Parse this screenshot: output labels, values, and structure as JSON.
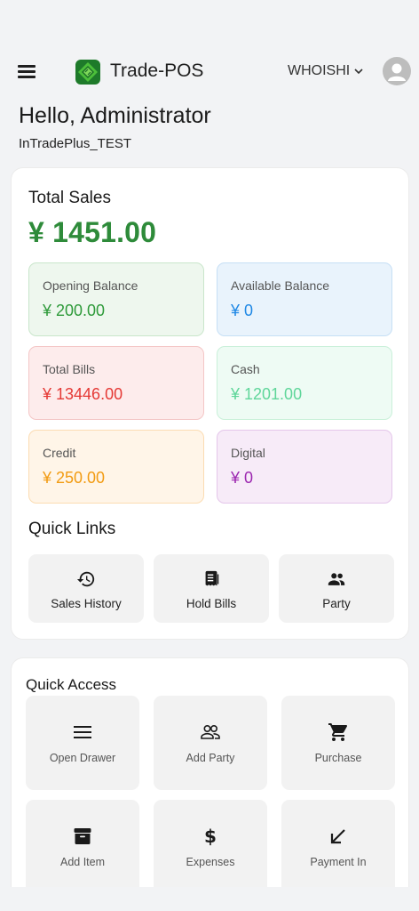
{
  "header": {
    "brand": "Trade-POS",
    "store_name": "WHOISHI",
    "greeting": "Hello, Administrator",
    "company": "InTradePlus_TEST"
  },
  "sales": {
    "title": "Total Sales",
    "total": "¥ 1451.00",
    "stats": [
      {
        "label": "Opening Balance",
        "value": "¥ 200.00",
        "color": "#2e9a3a"
      },
      {
        "label": "Available Balance",
        "value": "¥ 0",
        "color": "#1f88e5"
      },
      {
        "label": "Total Bills",
        "value": "¥ 13446.00",
        "color": "#e53935"
      },
      {
        "label": "Cash",
        "value": "¥ 1201.00",
        "color": "#5fd69a"
      },
      {
        "label": "Credit",
        "value": "¥ 250.00",
        "color": "#f29b12"
      },
      {
        "label": "Digital",
        "value": "¥ 0",
        "color": "#9c27b0"
      }
    ]
  },
  "quick_links": {
    "title": "Quick Links",
    "items": [
      {
        "label": "Sales History",
        "icon": "history-icon"
      },
      {
        "label": "Hold Bills",
        "icon": "receipt-icon"
      },
      {
        "label": "Party",
        "icon": "people-icon"
      }
    ]
  },
  "quick_access": {
    "title": "Quick Access",
    "items": [
      {
        "label": "Open Drawer",
        "icon": "menu-lines-icon"
      },
      {
        "label": "Add Party",
        "icon": "people-outline-icon"
      },
      {
        "label": "Purchase",
        "icon": "cart-icon"
      },
      {
        "label": "Add Item",
        "icon": "archive-box-icon"
      },
      {
        "label": "Expenses",
        "icon": "dollar-icon"
      },
      {
        "label": "Payment In",
        "icon": "arrow-down-left-icon"
      }
    ]
  },
  "colors": {
    "accent_green": "#2e8b3a",
    "background": "#f2f3f5"
  }
}
